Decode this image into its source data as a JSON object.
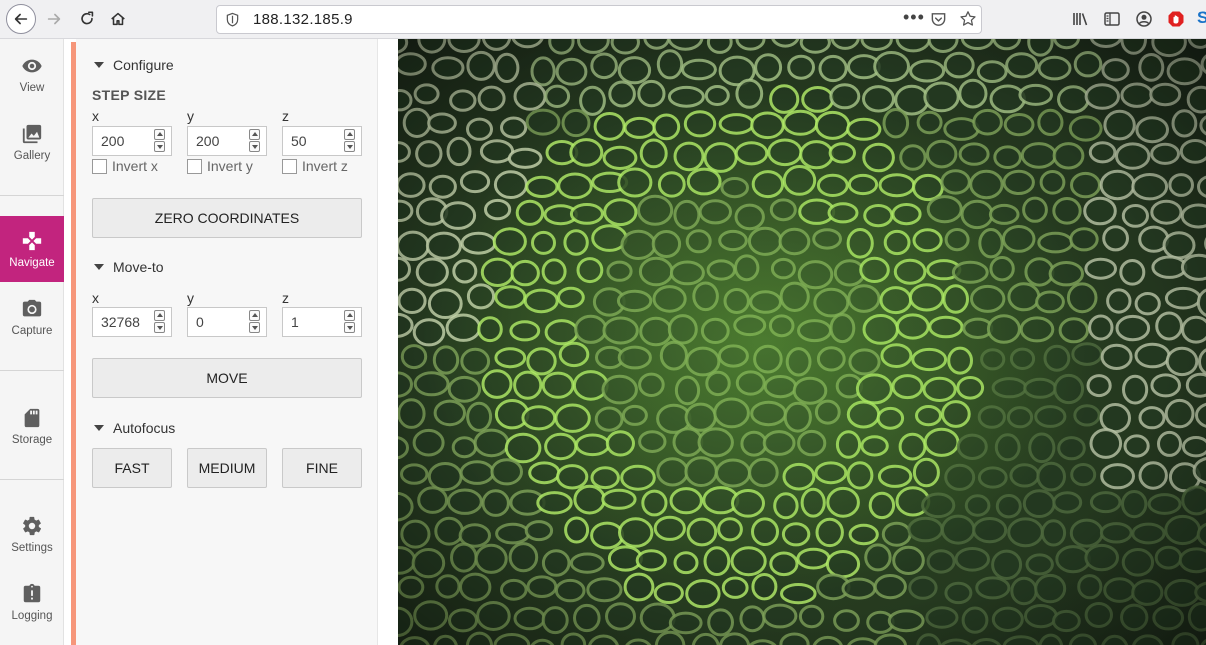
{
  "browser": {
    "url": "188.132.185.9"
  },
  "rail": {
    "items": [
      {
        "label": "View",
        "icon": "eye-icon"
      },
      {
        "label": "Gallery",
        "icon": "gallery-icon"
      },
      {
        "label": "Navigate",
        "icon": "gamepad-icon",
        "active": true
      },
      {
        "label": "Capture",
        "icon": "camera-icon"
      },
      {
        "label": "Storage",
        "icon": "sd-card-icon"
      },
      {
        "label": "Settings",
        "icon": "gear-icon"
      },
      {
        "label": "Logging",
        "icon": "clipboard-alert-icon"
      }
    ],
    "active_color": "#c2247e",
    "accent_color": "#f6967a"
  },
  "configure": {
    "title": "Configure",
    "step_size_label": "STEP SIZE",
    "axes": [
      {
        "label": "x",
        "value": "200",
        "invert_label": "Invert x",
        "inverted": false
      },
      {
        "label": "y",
        "value": "200",
        "invert_label": "Invert y",
        "inverted": false
      },
      {
        "label": "z",
        "value": "50",
        "invert_label": "Invert z",
        "inverted": false
      }
    ],
    "zero_button": "ZERO COORDINATES"
  },
  "move_to": {
    "title": "Move-to",
    "axes": [
      {
        "label": "x",
        "value": "32768"
      },
      {
        "label": "y",
        "value": "0"
      },
      {
        "label": "z",
        "value": "1"
      }
    ],
    "move_button": "MOVE"
  },
  "autofocus": {
    "title": "Autofocus",
    "buttons": [
      "FAST",
      "MEDIUM",
      "FINE"
    ]
  },
  "feed": {
    "description_icon": "microscope-image"
  }
}
